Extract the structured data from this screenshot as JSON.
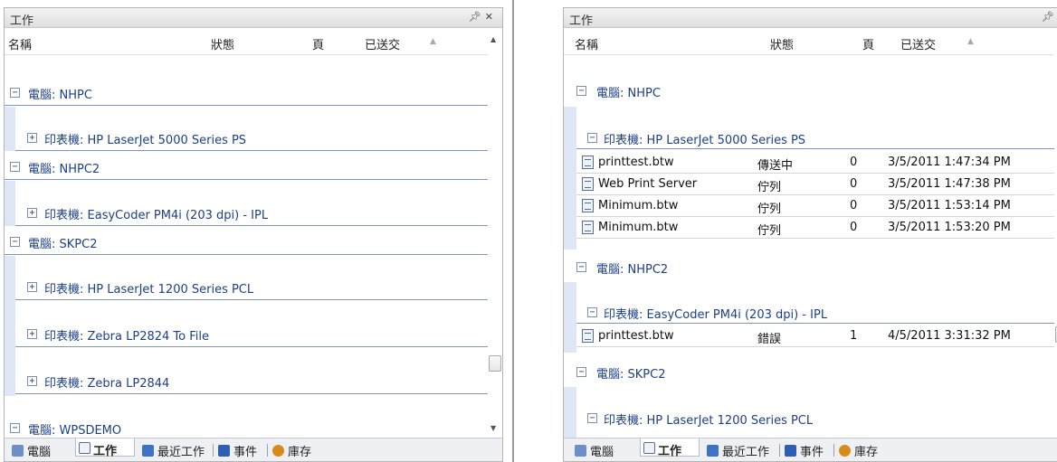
{
  "left": {
    "title": "工作",
    "columns": {
      "name": "名稱",
      "status": "狀態",
      "pages": "頁",
      "submitted": "已送交"
    },
    "groups": [
      {
        "label": "電腦: NHPC",
        "printers": [
          "印表機: HP LaserJet 5000 Series PS"
        ]
      },
      {
        "label": "電腦: NHPC2",
        "printers": [
          "印表機: EasyCoder PM4i (203 dpi) - IPL"
        ]
      },
      {
        "label": "電腦: SKPC2",
        "printers": [
          "印表機: HP LaserJet 1200 Series PCL",
          "印表機: Zebra LP2824 To File",
          "印表機: Zebra LP2844"
        ]
      },
      {
        "label": "電腦: WPSDEMO"
      }
    ]
  },
  "right": {
    "title": "工作",
    "columns": {
      "name": "名稱",
      "status": "狀態",
      "pages": "頁",
      "submitted": "已送交"
    },
    "groups": [
      {
        "label": "電腦: NHPC",
        "printer": "印表機: HP LaserJet 5000 Series PS",
        "jobs": [
          {
            "name": "printtest.btw",
            "status": "傳送中",
            "pages": "0",
            "submitted": "3/5/2011 1:47:34 PM"
          },
          {
            "name": "Web Print Server",
            "status": "佇列",
            "pages": "0",
            "submitted": "3/5/2011 1:47:38 PM"
          },
          {
            "name": "Minimum.btw",
            "status": "佇列",
            "pages": "0",
            "submitted": "3/5/2011 1:53:14 PM"
          },
          {
            "name": "Minimum.btw",
            "status": "佇列",
            "pages": "0",
            "submitted": "3/5/2011 1:53:20 PM"
          }
        ]
      },
      {
        "label": "電腦: NHPC2",
        "printer": "印表機: EasyCoder PM4i (203 dpi) - IPL",
        "jobs": [
          {
            "name": "printtest.btw",
            "status": "錯誤",
            "pages": "1",
            "submitted": "4/5/2011 3:31:32 PM"
          }
        ]
      },
      {
        "label": "電腦: SKPC2",
        "printer": "印表機: HP LaserJet 1200 Series PCL"
      }
    ]
  },
  "tabs": [
    "電腦",
    "工作",
    "最近工作",
    "事件",
    "庫存"
  ],
  "icons": {
    "pin": "pin-icon",
    "close": "close-icon",
    "sort": "sort-ascending-icon",
    "expand": "plus-box-icon",
    "collapse": "minus-box-icon",
    "document": "document-icon"
  },
  "colors": {
    "group_text": "#1c3f86",
    "group_line": "#7c95c9",
    "gutter": "#dfe7f6"
  }
}
